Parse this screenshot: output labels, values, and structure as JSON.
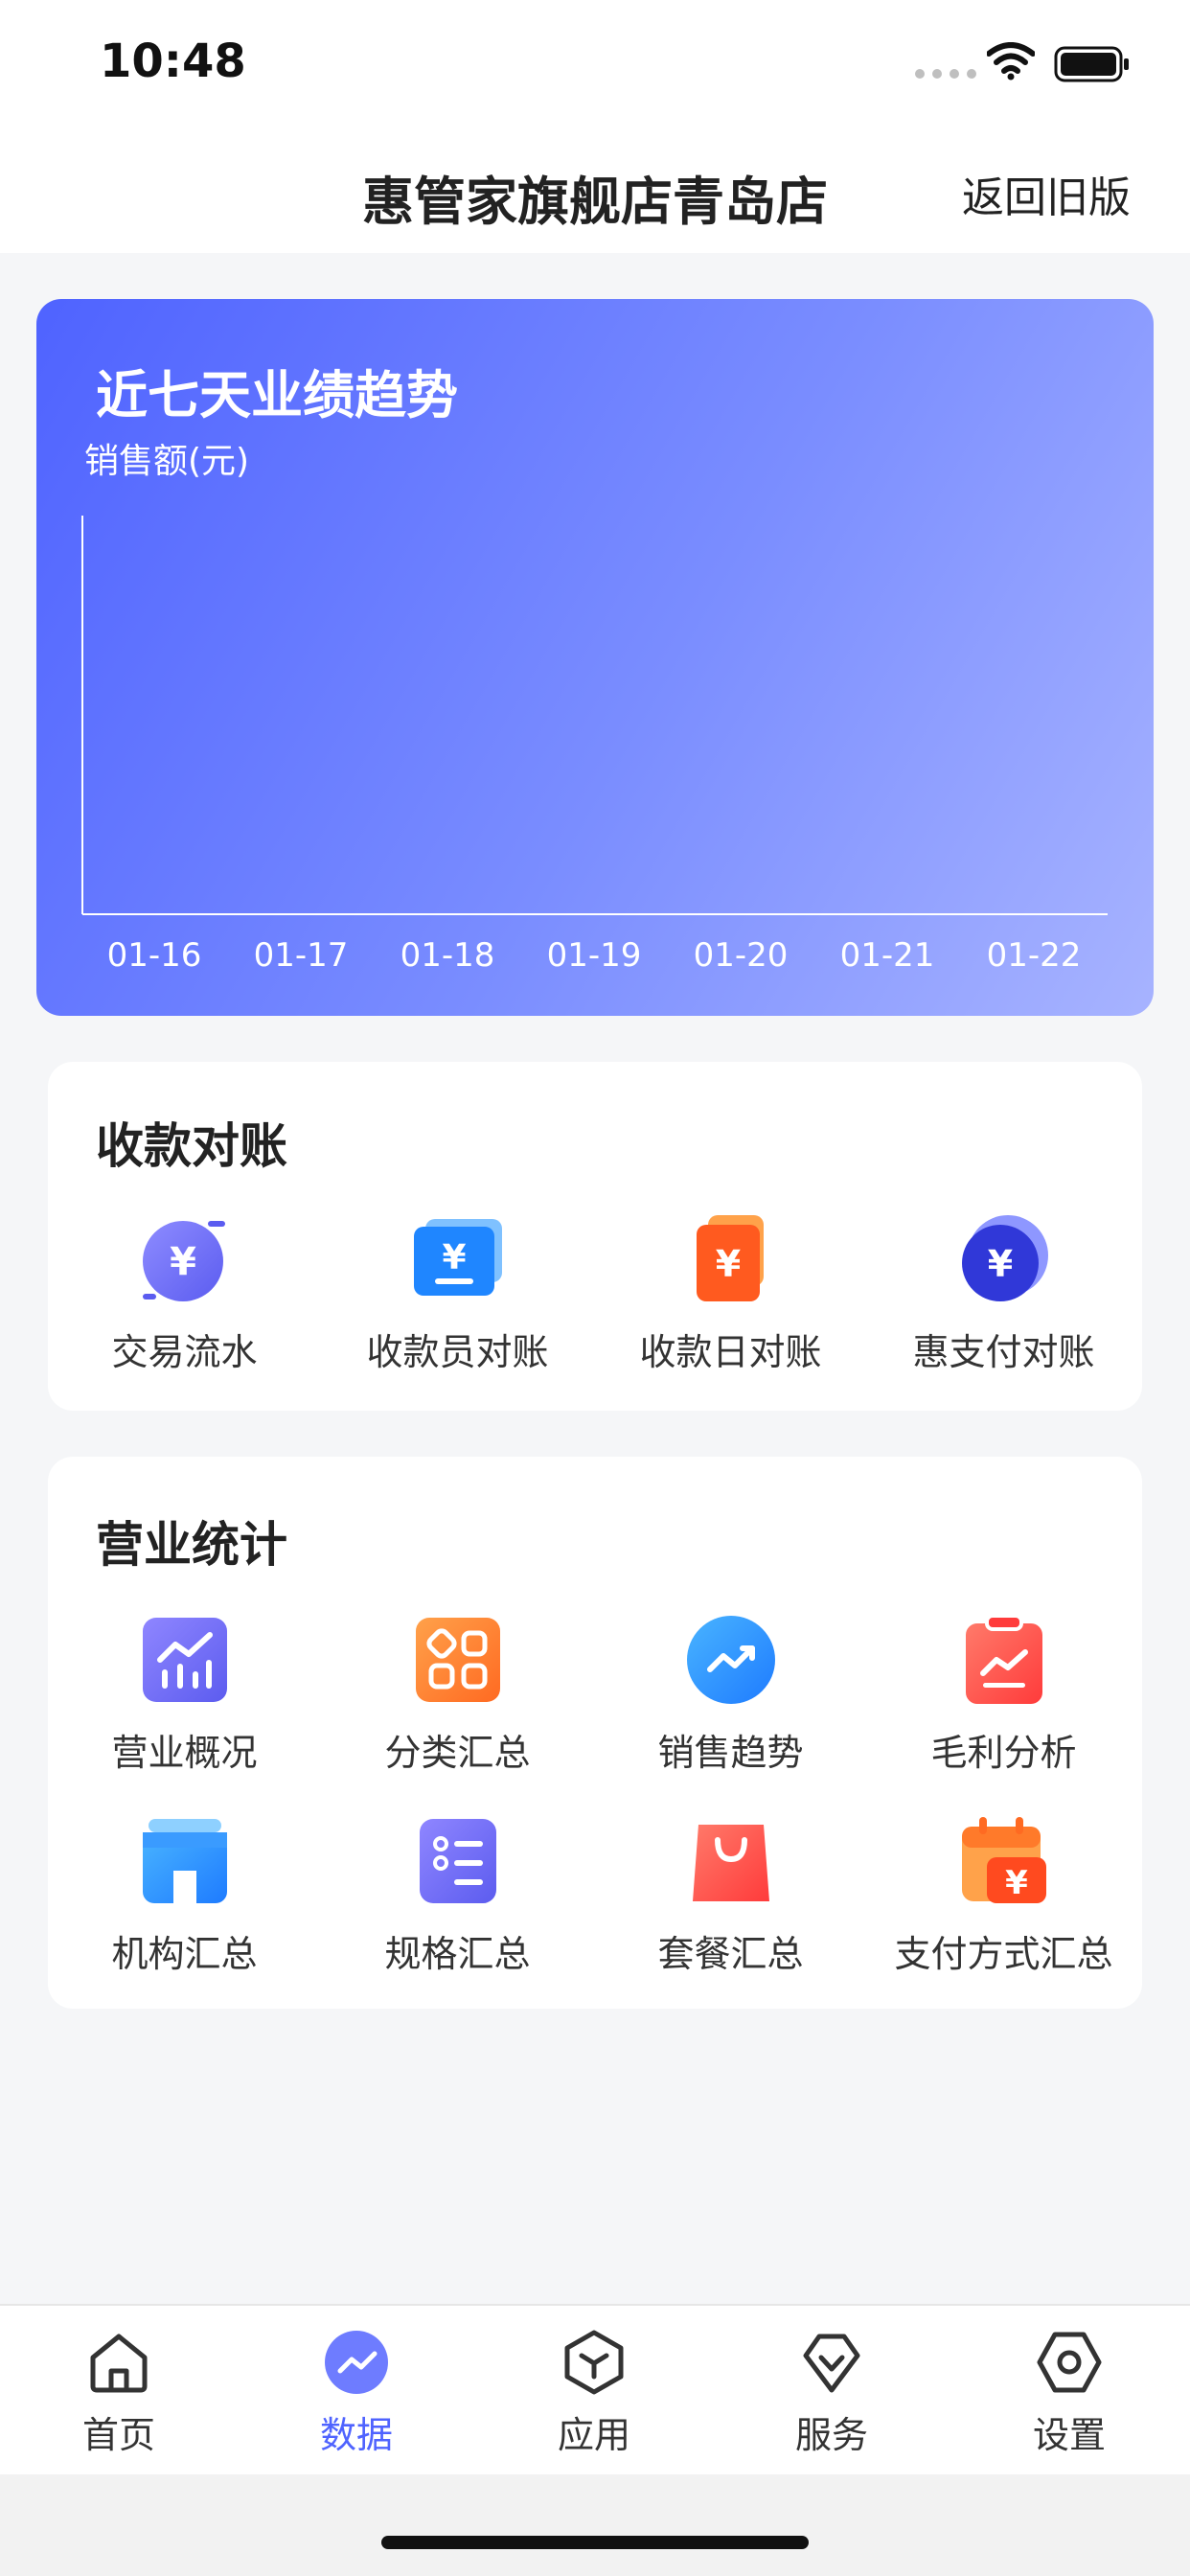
{
  "status_bar": {
    "time": "10:48"
  },
  "nav": {
    "title": "惠管家旗舰店青岛店",
    "back_old": "返回旧版"
  },
  "trend": {
    "title": "近七天业绩趋势",
    "ylabel": "销售额(元)"
  },
  "chart_data": {
    "type": "line",
    "title": "近七天业绩趋势",
    "ylabel": "销售额(元)",
    "xlabel": "",
    "categories": [
      "01-16",
      "01-17",
      "01-18",
      "01-19",
      "01-20",
      "01-21",
      "01-22"
    ],
    "series": [],
    "grid": false
  },
  "reconcile": {
    "title": "收款对账",
    "items": [
      {
        "label": "交易流水",
        "icon": "transaction-flow-icon",
        "color": "#6A6CF6"
      },
      {
        "label": "收款员对账",
        "icon": "cashier-reconcile-icon",
        "color": "#2D8CFF"
      },
      {
        "label": "收款日对账",
        "icon": "daily-reconcile-icon",
        "color": "#FF6A2A"
      },
      {
        "label": "惠支付对账",
        "icon": "hui-pay-reconcile-icon",
        "color": "#3F46E8"
      }
    ]
  },
  "business": {
    "title": "营业统计",
    "items": [
      {
        "label": "营业概况",
        "icon": "business-overview-icon",
        "color": "#6A6CF6"
      },
      {
        "label": "分类汇总",
        "icon": "category-summary-icon",
        "color": "#FF7A2A"
      },
      {
        "label": "销售趋势",
        "icon": "sales-trend-icon",
        "color": "#2D8CFF"
      },
      {
        "label": "毛利分析",
        "icon": "gross-profit-icon",
        "color": "#FF4D4D"
      },
      {
        "label": "机构汇总",
        "icon": "store-summary-icon",
        "color": "#2D8CFF"
      },
      {
        "label": "规格汇总",
        "icon": "spec-summary-icon",
        "color": "#6A6CF6"
      },
      {
        "label": "套餐汇总",
        "icon": "package-summary-icon",
        "color": "#FF4D4D"
      },
      {
        "label": "支付方式汇总",
        "icon": "payment-method-icon",
        "color": "#FF7A2A"
      }
    ]
  },
  "tabbar": {
    "items": [
      {
        "label": "首页",
        "icon": "home-icon"
      },
      {
        "label": "数据",
        "icon": "data-icon",
        "active": true
      },
      {
        "label": "应用",
        "icon": "apps-icon"
      },
      {
        "label": "服务",
        "icon": "service-icon"
      },
      {
        "label": "设置",
        "icon": "settings-icon"
      }
    ]
  },
  "colors": {
    "accent": "#4F63FF",
    "background": "#F5F6F8"
  }
}
